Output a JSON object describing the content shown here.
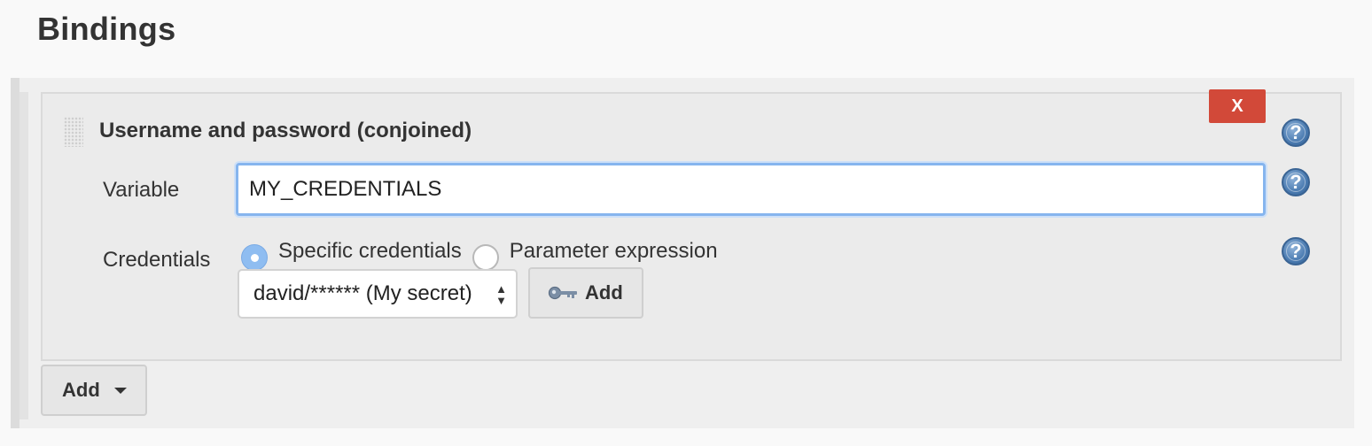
{
  "section": {
    "title": "Bindings"
  },
  "binding": {
    "title": "Username and password (conjoined)",
    "delete_label": "X",
    "variable": {
      "label": "Variable",
      "value": "MY_CREDENTIALS"
    },
    "credentials": {
      "label": "Credentials",
      "options": [
        {
          "label": "Specific credentials",
          "checked": true
        },
        {
          "label": "Parameter expression",
          "checked": false
        }
      ],
      "selected": "david/****** (My secret)",
      "add_label": "Add"
    }
  },
  "footer": {
    "add_label": "Add"
  },
  "icons": {
    "help": "question-mark-icon",
    "key": "key-icon",
    "caret": "caret-down-icon",
    "drag": "drag-handle-icon"
  },
  "colors": {
    "delete_button": "#d24939",
    "help_icon": "#4f7fb4",
    "focus_border": "#86b5ee",
    "radio_checked": "#8fbdf1"
  }
}
